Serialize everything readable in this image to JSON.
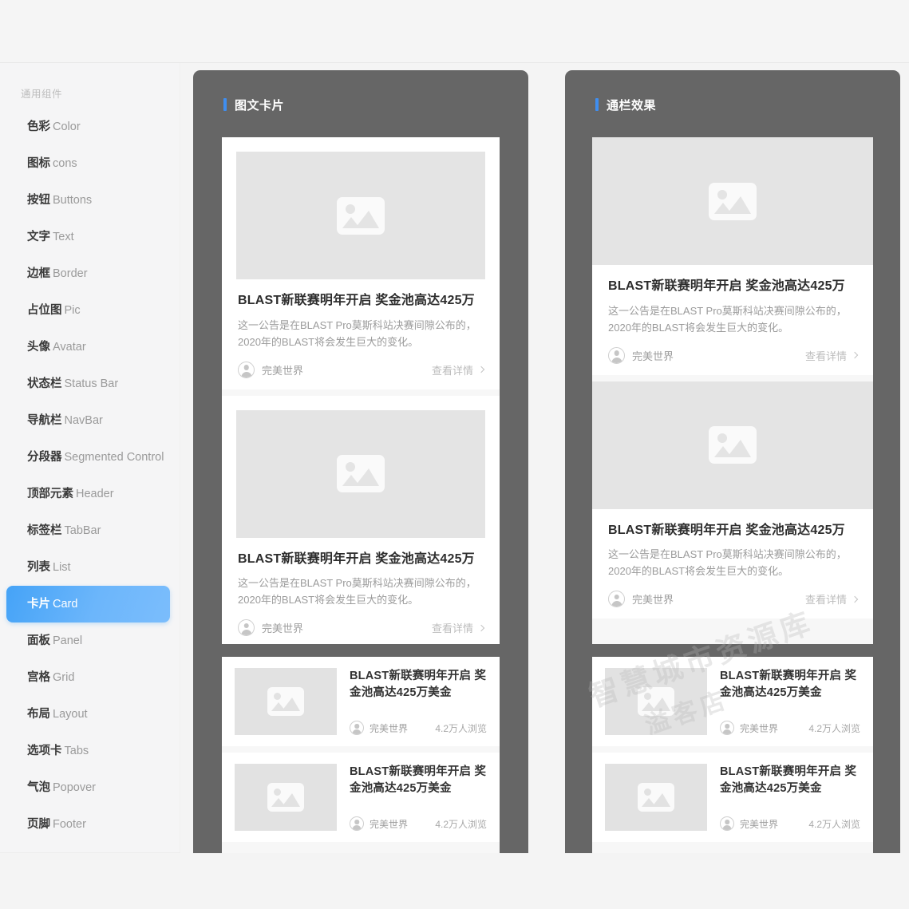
{
  "sidebar": {
    "heading": "通用组件",
    "items": [
      {
        "cn": "色彩",
        "en": "Color",
        "active": false
      },
      {
        "cn": "图标",
        "en": "cons",
        "active": false
      },
      {
        "cn": "按钮",
        "en": "Buttons",
        "active": false
      },
      {
        "cn": "文字",
        "en": "Text",
        "active": false
      },
      {
        "cn": "边框",
        "en": "Border",
        "active": false
      },
      {
        "cn": "占位图",
        "en": "Pic",
        "active": false
      },
      {
        "cn": "头像",
        "en": "Avatar",
        "active": false
      },
      {
        "cn": "状态栏",
        "en": "Status Bar",
        "active": false
      },
      {
        "cn": "导航栏",
        "en": "NavBar",
        "active": false
      },
      {
        "cn": "分段器",
        "en": "Segmented Control",
        "active": false
      },
      {
        "cn": "顶部元素",
        "en": "Header",
        "active": false
      },
      {
        "cn": "标签栏",
        "en": "TabBar",
        "active": false
      },
      {
        "cn": "列表",
        "en": "List",
        "active": false
      },
      {
        "cn": "卡片",
        "en": "Card",
        "active": true
      },
      {
        "cn": "面板",
        "en": "Panel",
        "active": false
      },
      {
        "cn": "宫格",
        "en": "Grid",
        "active": false
      },
      {
        "cn": "布局",
        "en": "Layout",
        "active": false
      },
      {
        "cn": "选项卡",
        "en": "Tabs",
        "active": false
      },
      {
        "cn": "气泡",
        "en": "Popover",
        "active": false
      },
      {
        "cn": "页脚",
        "en": "Footer",
        "active": false
      }
    ]
  },
  "panels": [
    {
      "title": "图文卡片",
      "variant": "inset",
      "image_text_cards": [
        {
          "title": "BLAST新联赛明年开启 奖金池高达425万",
          "desc": "这一公告是在BLAST Pro莫斯科站决赛间隙公布的，2020年的BLAST将会发生巨大的变化。",
          "author": "完美世界",
          "link": "查看详情",
          "thumb": "image-placeholder"
        },
        {
          "title": "BLAST新联赛明年开启 奖金池高达425万",
          "desc": "这一公告是在BLAST Pro莫斯科站决赛间隙公布的，2020年的BLAST将会发生巨大的变化。",
          "author": "完美世界",
          "link": "查看详情",
          "thumb": "image-placeholder"
        }
      ],
      "list_cards": [
        {
          "title": "BLAST新联赛明年开启 奖金池高达425万美金",
          "author": "完美世界",
          "views": "4.2万人浏览",
          "thumb": "image-placeholder"
        },
        {
          "title": "BLAST新联赛明年开启 奖金池高达425万美金",
          "author": "完美世界",
          "views": "4.2万人浏览",
          "thumb": "image-placeholder"
        }
      ]
    },
    {
      "title": "通栏效果",
      "variant": "bleed",
      "image_text_cards": [
        {
          "title": "BLAST新联赛明年开启 奖金池高达425万",
          "desc": "这一公告是在BLAST Pro莫斯科站决赛间隙公布的，2020年的BLAST将会发生巨大的变化。",
          "author": "完美世界",
          "link": "查看详情",
          "thumb": "image-placeholder"
        },
        {
          "title": "BLAST新联赛明年开启 奖金池高达425万",
          "desc": "这一公告是在BLAST Pro莫斯科站决赛间隙公布的，2020年的BLAST将会发生巨大的变化。",
          "author": "完美世界",
          "link": "查看详情",
          "thumb": "image-placeholder"
        }
      ],
      "list_cards": [
        {
          "title": "BLAST新联赛明年开启 奖金池高达425万美金",
          "author": "完美世界",
          "views": "4.2万人浏览",
          "thumb": "image-placeholder"
        },
        {
          "title": "BLAST新联赛明年开启 奖金池高达425万美金",
          "author": "完美世界",
          "views": "4.2万人浏览",
          "thumb": "image-placeholder"
        }
      ]
    }
  ],
  "watermark": {
    "line1": "智慧城市资源库",
    "line2": "溢客店"
  },
  "colors": {
    "accent": "#3f8ef0",
    "active_nav": "#5aabf9",
    "panel_bg": "#666666",
    "page_bg": "#f4f4f4",
    "sidebar_bg": "#f5f5f6"
  }
}
